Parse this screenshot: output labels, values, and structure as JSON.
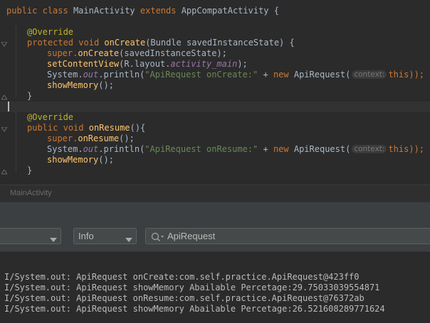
{
  "editor": {
    "lines": {
      "l1": {
        "kw_public": "public",
        "kw_class": "class",
        "class_name": "MainActivity",
        "kw_extends": "extends",
        "super_class": "AppCompatActivity",
        "brace": "{"
      },
      "l2": {
        "annotation": "@Override"
      },
      "l3": {
        "kw_protected": "protected",
        "kw_void": "void",
        "method": "onCreate",
        "params": "(Bundle savedInstanceState) {"
      },
      "l4": {
        "text": "super.",
        "call": "onCreate",
        "rest": "(savedInstanceState);"
      },
      "l5": {
        "call": "setContentView",
        "pre": "(R.layout.",
        "field": "activity_main",
        "rest": ");"
      },
      "l6": {
        "pre": "System.",
        "field": "out",
        "mid": ".println(",
        "string": "\"ApiRequest onCreate:\"",
        "plus": " + ",
        "kw_new": "new",
        "ctor": " ApiRequest(",
        "hint": "context:",
        "rest": "this));"
      },
      "l7": {
        "call": "showMemory",
        "rest": "();"
      },
      "l8": {
        "brace": "}"
      },
      "l10": {
        "annotation": "@Override"
      },
      "l11": {
        "kw_public": "public",
        "kw_void": "void",
        "method": "onResume",
        "params": "(){"
      },
      "l12": {
        "text": "super.",
        "call": "onResume",
        "rest": "();"
      },
      "l13": {
        "pre": "System.",
        "field": "out",
        "mid": ".println(",
        "string": "\"ApiRequest onResume:\"",
        "plus": " + ",
        "kw_new": "new",
        "ctor": " ApiRequest(",
        "hint": "context:",
        "rest": "this));"
      },
      "l14": {
        "call": "showMemory",
        "rest": "();"
      },
      "l15": {
        "brace": "}"
      }
    }
  },
  "breadcrumb": "MainActivity",
  "toolbar": {
    "level_select": "Info",
    "search_value": "ApiRequest"
  },
  "logcat": [
    "I/System.out: ApiRequest onCreate:com.self.practice.ApiRequest@423ff0",
    "I/System.out: ApiRequest showMemory Abailable Percetage:29.75033039554871",
    "I/System.out: ApiRequest onResume:com.self.practice.ApiRequest@76372ab",
    "I/System.out: ApiRequest showMemory Abailable Percetage:26.521608289771624"
  ],
  "colors": {
    "background": "#2b2b2b",
    "keyword": "#cc7832",
    "method": "#ffc66d",
    "string": "#6a8759",
    "field": "#9876aa",
    "annotation": "#bbb529"
  },
  "icons": {
    "search": "magnifier-icon",
    "dropdown": "chevron-down-icon"
  }
}
